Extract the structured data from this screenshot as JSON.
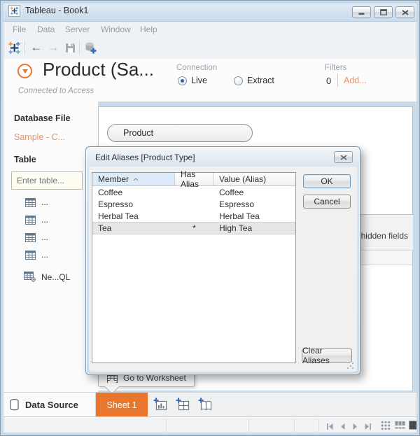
{
  "window": {
    "title": "Tableau - Book1"
  },
  "menubar": {
    "items": [
      "File",
      "Data",
      "Server",
      "Window",
      "Help"
    ]
  },
  "header": {
    "datasource_title": "Product (Sa...",
    "connection_label": "Connection",
    "live_label": "Live",
    "extract_label": "Extract",
    "filters_label": "Filters",
    "filters_count": "0",
    "add_label": "Add...",
    "status": "Connected to Access"
  },
  "sidebar": {
    "database_file_label": "Database File",
    "database_file_value": "Sample - C...",
    "table_label": "Table",
    "search_placeholder": "Enter table...",
    "tables": [
      "...",
      "...",
      "...",
      "..."
    ],
    "new_custom_sql_label": "Ne...QL"
  },
  "canvas": {
    "pill_label": "Product",
    "hidden_fields_label": "Show hidden fields"
  },
  "callout": {
    "label": "Go to Worksheet"
  },
  "dialog": {
    "title": "Edit Aliases [Product Type]",
    "columns": [
      "Member",
      "Has Alias",
      "Value (Alias)"
    ],
    "rows": [
      {
        "member": "Coffee",
        "has_alias": "",
        "value": "Coffee"
      },
      {
        "member": "Espresso",
        "has_alias": "",
        "value": "Espresso"
      },
      {
        "member": "Herbal Tea",
        "has_alias": "",
        "value": "Herbal Tea"
      },
      {
        "member": "Tea",
        "has_alias": "*",
        "value": "High Tea"
      }
    ],
    "ok_label": "OK",
    "cancel_label": "Cancel",
    "clear_label": "Clear Aliases"
  },
  "tabs": {
    "data_source_label": "Data Source",
    "sheet_label": "Sheet 1"
  },
  "colors": {
    "accent_orange": "#e8762d",
    "link_orange": "#e8936a",
    "selected_row": "#e6e6e6",
    "sorted_header": "#dcebf7",
    "chrome_blue": "#c9daea"
  }
}
